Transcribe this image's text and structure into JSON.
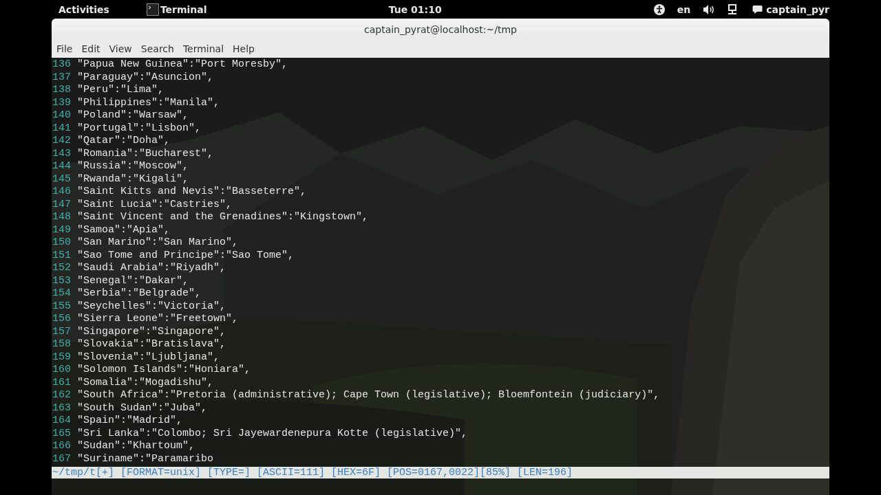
{
  "top_bar": {
    "activities": "Activities",
    "app_name": "Terminal",
    "clock": "Tue 01:10",
    "language": "en",
    "user": "captain_pyr"
  },
  "window": {
    "title": "captain_pyrat@localhost:~/tmp",
    "menu": [
      "File",
      "Edit",
      "View",
      "Search",
      "Terminal",
      "Help"
    ]
  },
  "lines": [
    {
      "number": "136",
      "text": "\"Papua New Guinea\":\"Port Moresby\","
    },
    {
      "number": "137",
      "text": "\"Paraguay\":\"Asuncion\","
    },
    {
      "number": "138",
      "text": "\"Peru\":\"Lima\","
    },
    {
      "number": "139",
      "text": "\"Philippines\":\"Manila\","
    },
    {
      "number": "140",
      "text": "\"Poland\":\"Warsaw\","
    },
    {
      "number": "141",
      "text": "\"Portugal\":\"Lisbon\","
    },
    {
      "number": "142",
      "text": "\"Qatar\":\"Doha\","
    },
    {
      "number": "143",
      "text": "\"Romania\":\"Bucharest\","
    },
    {
      "number": "144",
      "text": "\"Russia\":\"Moscow\","
    },
    {
      "number": "145",
      "text": "\"Rwanda\":\"Kigali\","
    },
    {
      "number": "146",
      "text": "\"Saint Kitts and Nevis\":\"Basseterre\","
    },
    {
      "number": "147",
      "text": "\"Saint Lucia\":\"Castries\","
    },
    {
      "number": "148",
      "text": "\"Saint Vincent and the Grenadines\":\"Kingstown\","
    },
    {
      "number": "149",
      "text": "\"Samoa\":\"Apia\","
    },
    {
      "number": "150",
      "text": "\"San Marino\":\"San Marino\","
    },
    {
      "number": "151",
      "text": "\"Sao Tome and Principe\":\"Sao Tome\","
    },
    {
      "number": "152",
      "text": "\"Saudi Arabia\":\"Riyadh\","
    },
    {
      "number": "153",
      "text": "\"Senegal\":\"Dakar\","
    },
    {
      "number": "154",
      "text": "\"Serbia\":\"Belgrade\","
    },
    {
      "number": "155",
      "text": "\"Seychelles\":\"Victoria\","
    },
    {
      "number": "156",
      "text": "\"Sierra Leone\":\"Freetown\","
    },
    {
      "number": "157",
      "text": "\"Singapore\":\"Singapore\","
    },
    {
      "number": "158",
      "text": "\"Slovakia\":\"Bratislava\","
    },
    {
      "number": "159",
      "text": "\"Slovenia\":\"Ljubljana\","
    },
    {
      "number": "160",
      "text": "\"Solomon Islands\":\"Honiara\","
    },
    {
      "number": "161",
      "text": "\"Somalia\":\"Mogadishu\","
    },
    {
      "number": "162",
      "text": "\"South Africa\":\"Pretoria (administrative); Cape Town (legislative); Bloemfontein (judiciary)\","
    },
    {
      "number": "163",
      "text": "\"South Sudan\":\"Juba\","
    },
    {
      "number": "164",
      "text": "\"Spain\":\"Madrid\","
    },
    {
      "number": "165",
      "text": "\"Sri Lanka\":\"Colombo; Sri Jayewardenepura Kotte (legislative)\","
    },
    {
      "number": "166",
      "text": "\"Sudan\":\"Khartoum\","
    },
    {
      "number": "167",
      "text": "\"Suriname\":\"Paramaribo"
    }
  ],
  "status_line": "~/tmp/t[+] [FORMAT=unix] [TYPE=] [ASCII=111] [HEX=6F] [POS=0167,0022][85%] [LEN=196]"
}
